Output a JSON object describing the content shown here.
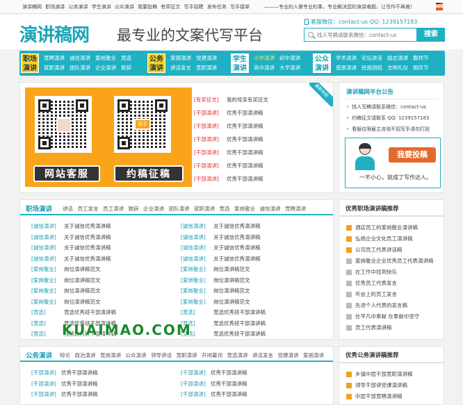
{
  "topbar": {
    "links": [
      "演讲稿网",
      "职场演讲",
      "公务演讲",
      "学生演讲",
      "公众演讲",
      "我要投稿",
      "有奖征文",
      "写手招聘",
      "发布任务",
      "写手接单"
    ],
    "slogan": "———专业的人做专业的事，专业解决您的演讲难题，让写作不再难！"
  },
  "header": {
    "logo": "演讲稿网",
    "tagline": "最专业的文案代写平台",
    "contact": "客服微信：contact-us    QQ: 1239157183",
    "search_placeholder": "找人写稿请联系微信：contact-us",
    "search_button": "搜索"
  },
  "nav": [
    {
      "badge1": "职场",
      "badge2": "演讲",
      "row1": [
        "竞聘演讲",
        "诚信演讲",
        "爱岗敬业",
        "竞选"
      ],
      "row2": [
        "就职演讲",
        "团队演讲",
        "企业演讲",
        "致辞"
      ]
    },
    {
      "badge1": "公务",
      "badge2": "演讲",
      "row1": [
        "爱国演讲",
        "党建演讲"
      ],
      "row2": [
        "讲话发言",
        "竞职演讲"
      ]
    },
    {
      "badge1": "学生",
      "badge2": "演讲",
      "row1": [
        "小学演讲",
        "初中演讲"
      ],
      "row2": [
        "高中演讲",
        "大学演讲"
      ]
    },
    {
      "badge1": "公众",
      "badge2": "演讲",
      "row1": [
        "学术演讲",
        "论坛讲话",
        "励志演讲",
        "教师节"
      ],
      "row2": [
        "感恩演讲",
        "民族团结",
        "文明礼仪",
        "国庆节"
      ]
    }
  ],
  "promo": {
    "banner_left": "网站客服",
    "banner_right": "约稿征稿",
    "qr_right_label": "写手",
    "ribbon": "最新快报",
    "items": [
      {
        "cat": "[有奖征文]",
        "title": "我的母亲有奖征文"
      },
      {
        "cat": "[干部演讲]",
        "title": "优秀干部演讲稿"
      },
      {
        "cat": "[干部演讲]",
        "title": "优秀干部演讲稿"
      },
      {
        "cat": "[干部演讲]",
        "title": "优秀干部演讲稿"
      },
      {
        "cat": "[干部演讲]",
        "title": "优秀干部演讲稿"
      },
      {
        "cat": "[干部演讲]",
        "title": "优秀干部演讲稿"
      },
      {
        "cat": "[干部演讲]",
        "title": "优秀干部演讲稿"
      }
    ]
  },
  "notice": {
    "title": "演讲稿网平台公告",
    "items": [
      "找人写稿请联系微信：contact-us",
      "约稿征文请联系 QQ: 1239157183",
      "看服仅限雇主咨询不招写手请勿打扰"
    ],
    "submit_button": "我要投稿",
    "submit_slogan": "一不小心，就成了写作达人。"
  },
  "section1": {
    "title": "职场演讲",
    "tabs": [
      "讲话",
      "员工发言",
      "员工演讲",
      "致辞",
      "企业演讲",
      "团队演讲",
      "就职演讲",
      "竞选",
      "爱岗敬业",
      "诚信演讲",
      "竞聘演讲"
    ],
    "left": [
      {
        "cat": "[诚信演讲]",
        "title": "关于诚信优秀演讲稿"
      },
      {
        "cat": "[诚信演讲]",
        "title": "关于诚信优秀演讲稿"
      },
      {
        "cat": "[诚信演讲]",
        "title": "关于诚信优秀演讲稿"
      },
      {
        "cat": "[诚信演讲]",
        "title": "关于诚信优秀演讲稿"
      },
      {
        "cat": "[爱岗敬业]",
        "title": "岗位演讲稿范文"
      },
      {
        "cat": "[爱岗敬业]",
        "title": "岗位演讲稿范文"
      },
      {
        "cat": "[爱岗敬业]",
        "title": "岗位演讲稿范文"
      },
      {
        "cat": "[爱岗敬业]",
        "title": "岗位演讲稿范文"
      },
      {
        "cat": "[竞选]",
        "title": "竞选优秀班干部演讲稿"
      },
      {
        "cat": "[竞选]",
        "title": "竞选优秀班干部演讲稿"
      },
      {
        "cat": "[竞选]",
        "title": "竞选优秀班干部演讲稿"
      }
    ],
    "right": [
      {
        "cat": "[诚信演讲]",
        "title": "关于诚信优秀演讲稿"
      },
      {
        "cat": "[诚信演讲]",
        "title": "关于诚信优秀演讲稿"
      },
      {
        "cat": "[诚信演讲]",
        "title": "关于诚信优秀演讲稿"
      },
      {
        "cat": "[诚信演讲]",
        "title": "关于诚信优秀演讲稿"
      },
      {
        "cat": "[爱岗敬业]",
        "title": "岗位演讲稿范文"
      },
      {
        "cat": "[爱岗敬业]",
        "title": "岗位演讲稿范文"
      },
      {
        "cat": "[爱岗敬业]",
        "title": "岗位演讲稿范文"
      },
      {
        "cat": "[爱岗敬业]",
        "title": "岗位演讲稿范文"
      },
      {
        "cat": "[竞选]",
        "title": "竞选优秀班干部演讲稿"
      },
      {
        "cat": "[竞选]",
        "title": "竞选优秀班干部演讲稿"
      },
      {
        "cat": "[竞选]",
        "title": "竞选优秀班干部演讲稿"
      }
    ],
    "watermark": "KUAIMAO.COM"
  },
  "section2": {
    "title": "公务演讲",
    "tabs": [
      "辩论",
      "政治演讲",
      "竞岗演讲",
      "公众演讲",
      "领导讲话",
      "竞职演讲",
      "开闭幕词",
      "竞选演讲",
      "讲话发言",
      "党建演讲",
      "爱国演讲"
    ],
    "left": [
      {
        "cat": "[干部演讲]",
        "title": "优秀干部演讲稿"
      },
      {
        "cat": "[干部演讲]",
        "title": "优秀干部演讲稿"
      },
      {
        "cat": "[干部演讲]",
        "title": "优秀干部演讲稿"
      }
    ],
    "right": [
      {
        "cat": "[干部演讲]",
        "title": "优秀干部演讲稿"
      },
      {
        "cat": "[干部演讲]",
        "title": "优秀干部演讲稿"
      },
      {
        "cat": "[干部演讲]",
        "title": "优秀干部演讲稿"
      }
    ]
  },
  "rank1": {
    "title": "优秀职场演讲稿推荐",
    "items": [
      "酒店员工的爱岗敬业演讲稿",
      "弘扬企业文化员工演讲稿",
      "公司员工代表讲话稿",
      "爱岗敬业企业优秀员工代表演讲稿",
      "在工作中找到快乐",
      "优秀员工代表发言",
      "年会上的员工发言",
      "先进个人代表的发言稿",
      "在平凡中奉献 在奉献中坚守",
      "员工代表演讲稿"
    ]
  },
  "rank2": {
    "title": "优秀公务演讲稿推荐",
    "items": [
      "乡镇中层干部竞职演讲稿",
      "领导干部讲党课演讲稿",
      "中层干部竞聘演讲稿"
    ]
  }
}
